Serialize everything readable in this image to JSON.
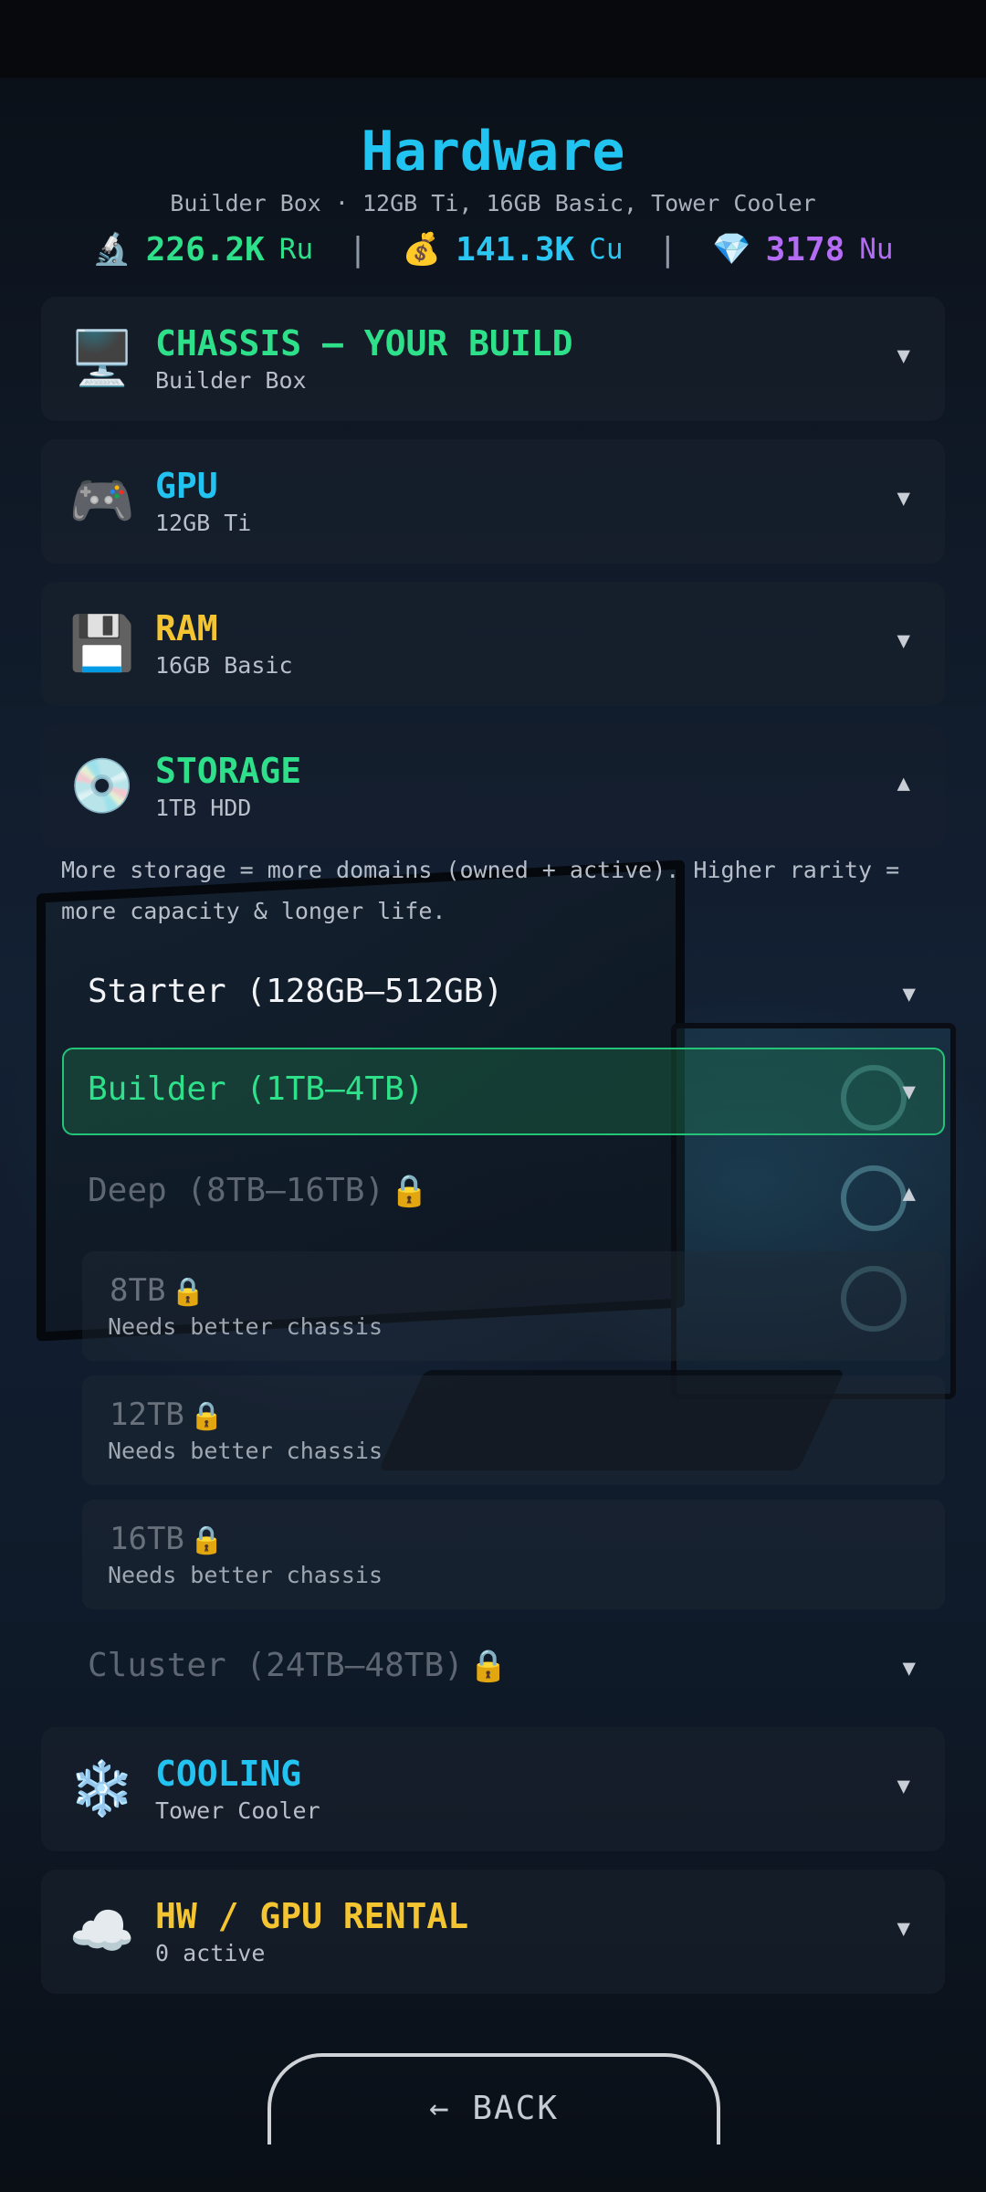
{
  "header": {
    "title": "Hardware",
    "subtitle": "Builder Box · 12GB Ti, 16GB Basic, Tower Cooler"
  },
  "stats": [
    {
      "icon": "microscope-icon",
      "emoji": "🔬",
      "value": "226.2K",
      "unit": "Ru",
      "color": "#2ee08a"
    },
    {
      "icon": "money-bag-icon",
      "emoji": "💰",
      "value": "141.3K",
      "unit": "Cu",
      "color": "#2bc6f2"
    },
    {
      "icon": "gem-icon",
      "emoji": "💎",
      "value": "3178",
      "unit": "Nu",
      "color": "#b46cf5"
    }
  ],
  "sections": {
    "chassis": {
      "icon": "monitor-icon",
      "emoji": "🖥️",
      "title": "CHASSIS — YOUR BUILD",
      "subtitle": "Builder Box",
      "color": "#2ee08a",
      "expanded": false
    },
    "gpu": {
      "icon": "gamepad-icon",
      "emoji": "🎮",
      "title": "GPU",
      "subtitle": "12GB Ti",
      "color": "#22c3f0",
      "expanded": false
    },
    "ram": {
      "icon": "floppy-disk-icon",
      "emoji": "💾",
      "title": "RAM",
      "subtitle": "16GB Basic",
      "color": "#f5c531",
      "expanded": false
    },
    "storage": {
      "icon": "disc-icon",
      "emoji": "💿",
      "title": "STORAGE",
      "subtitle": "1TB HDD",
      "color": "#2ee08a",
      "expanded": true
    },
    "cooling": {
      "icon": "snowflake-icon",
      "emoji": "❄️",
      "title": "COOLING",
      "subtitle": "Tower Cooler",
      "color": "#22c3f0",
      "expanded": false
    },
    "rental": {
      "icon": "cloud-icon",
      "emoji": "☁️",
      "title": "HW / GPU RENTAL",
      "subtitle": "0 active",
      "color": "#f5c531",
      "expanded": false
    }
  },
  "storage_detail": {
    "description": "More storage = more domains (owned + active). Higher rarity = more capacity & longer life.",
    "tiers": {
      "starter": {
        "label": "Starter (128GB–512GB)",
        "locked": false,
        "selected": false
      },
      "builder": {
        "label": "Builder (1TB–4TB)",
        "locked": false,
        "selected": true
      },
      "deep": {
        "label": "Deep (8TB–16TB)",
        "locked": true,
        "selected": false,
        "expanded": true
      },
      "cluster": {
        "label": "Cluster (24TB–48TB)",
        "locked": true,
        "selected": false
      }
    },
    "deep_items": [
      {
        "name": "8TB",
        "requirement": "Needs better chassis",
        "locked": true
      },
      {
        "name": "12TB",
        "requirement": "Needs better chassis",
        "locked": true
      },
      {
        "name": "16TB",
        "requirement": "Needs better chassis",
        "locked": true
      }
    ]
  },
  "icons": {
    "collapsed": "▼",
    "expanded": "▲",
    "lock": "🔒"
  },
  "back_button": {
    "label": "← BACK"
  }
}
